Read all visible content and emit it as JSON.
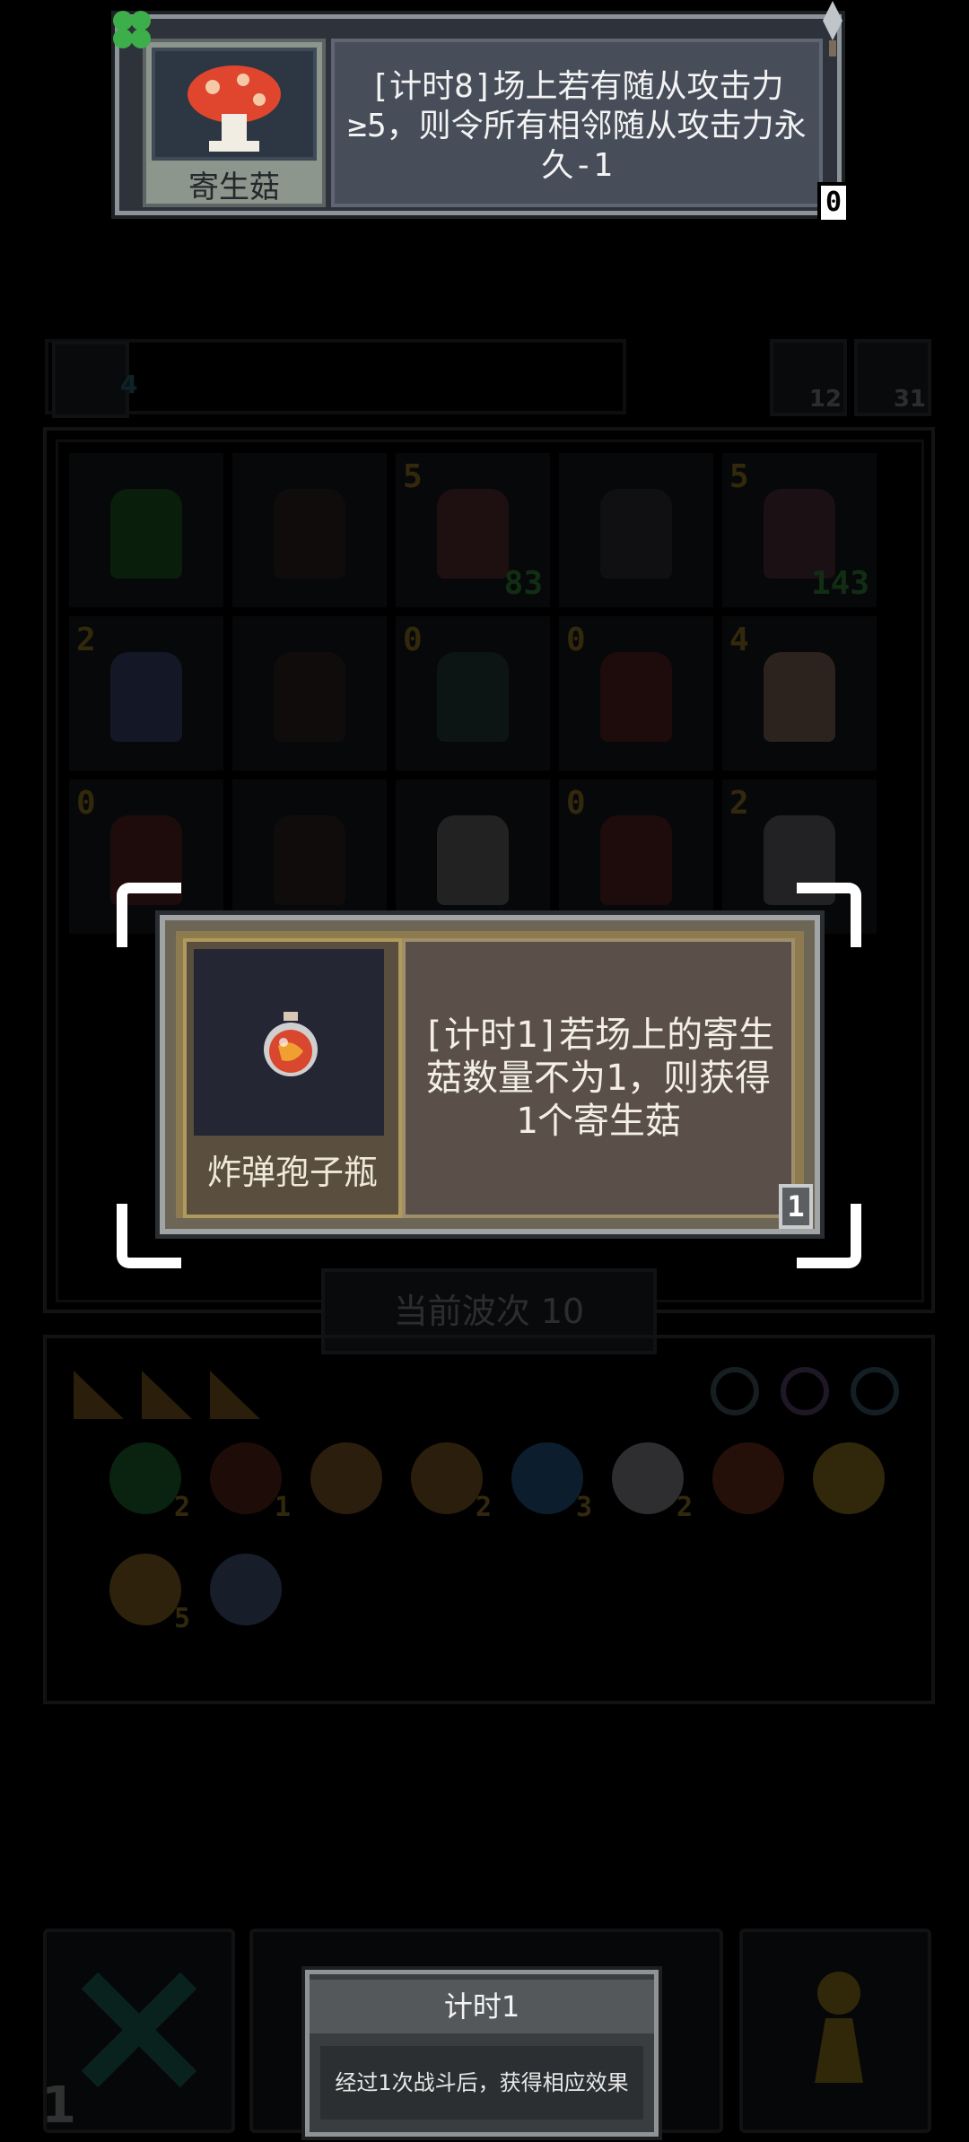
{
  "summon_card": {
    "name": "寄生菇",
    "description": "[计时8]场上若有随从攻击力≥5，则令所有相邻随从攻击力永久-1",
    "counter": "0"
  },
  "relic_card": {
    "name": "炸弹孢子瓶",
    "description": "[计时1]若场上的寄生菇数量不为1，则获得1个寄生菇",
    "counter": "1"
  },
  "stats": {
    "hourglass": "4",
    "reroll": "12",
    "key": "31"
  },
  "board": {
    "rows": [
      [
        {
          "lvl": "",
          "atk": "",
          "color": "#2f8a3a"
        },
        {
          "lvl": "",
          "atk": "",
          "color": "#4a3a3a"
        },
        {
          "lvl": "5",
          "atk": "83",
          "color": "#8a4a48"
        },
        {
          "lvl": "",
          "atk": "",
          "color": "#4a4c56"
        },
        {
          "lvl": "5",
          "atk": "143",
          "color": "#7a4a58"
        }
      ],
      [
        {
          "lvl": "2",
          "atk": "",
          "color": "#5a68a8"
        },
        {
          "lvl": "",
          "atk": "",
          "color": "#4a3a3a"
        },
        {
          "lvl": "0",
          "atk": "",
          "color": "#3d5a5a"
        },
        {
          "lvl": "0",
          "atk": "",
          "color": "#8a3a3a"
        },
        {
          "lvl": "4",
          "atk": "",
          "color": "#c9a08a"
        }
      ],
      [
        {
          "lvl": "0",
          "atk": "",
          "color": "#8a3a3a"
        },
        {
          "lvl": "",
          "atk": "",
          "color": "#4a3a3a"
        },
        {
          "lvl": "",
          "atk": "",
          "color": "#9a9a9a"
        },
        {
          "lvl": "0",
          "atk": "",
          "color": "#8a3a3a"
        },
        {
          "lvl": "2",
          "atk": "",
          "color": "#9a9aa8"
        }
      ]
    ]
  },
  "wave_label": "当前波次 10",
  "items": [
    {
      "icon": "emerald-icon",
      "count": "2",
      "color": "#2f9a4a"
    },
    {
      "icon": "bomb-bottle-icon",
      "count": "1",
      "color": "#8a3a2a"
    },
    {
      "icon": "pickaxe-icon",
      "count": "",
      "color": "#c98a3a"
    },
    {
      "icon": "horn-icon",
      "count": "2",
      "color": "#c98a3a"
    },
    {
      "icon": "orb-icon",
      "count": "3",
      "color": "#3a8ad0"
    },
    {
      "icon": "axe-icon",
      "count": "2",
      "color": "#d0d0e0"
    },
    {
      "icon": "brush-icon",
      "count": "",
      "color": "#a84a2a"
    },
    {
      "icon": "trophy-icon",
      "count": "",
      "color": "#e0b030"
    },
    {
      "icon": "ring-icon",
      "count": "5",
      "color": "#d09a3a"
    },
    {
      "icon": "feather-icon",
      "count": "",
      "color": "#6a8ac0"
    }
  ],
  "bottom": {
    "left_counter": "1"
  },
  "tooltip": {
    "title": "计时1",
    "body": "经过1次战斗后，获得相应效果"
  }
}
